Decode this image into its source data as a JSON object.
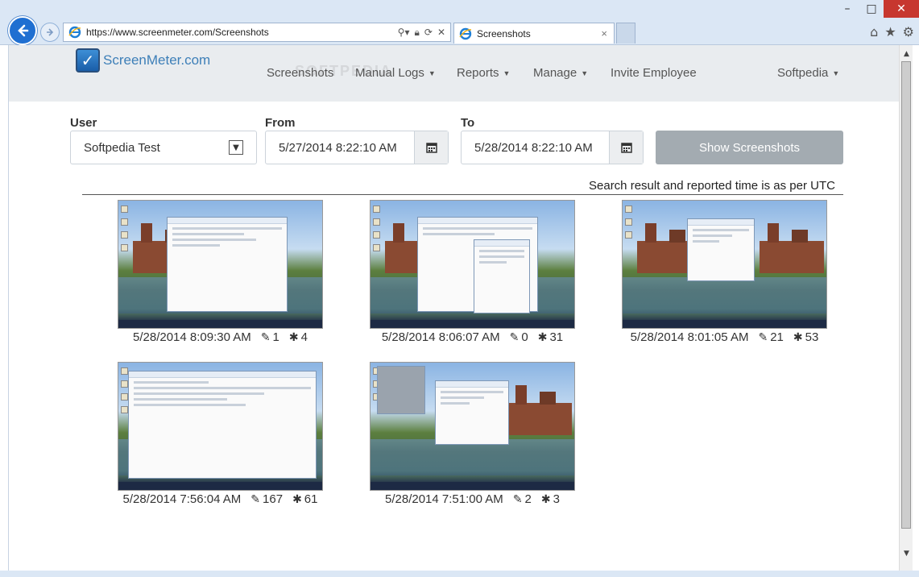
{
  "browser": {
    "url": "https://www.screenmeter.com/Screenshots",
    "tab_title": "Screenshots",
    "tab_close": "×"
  },
  "site": {
    "brand": "ScreenMeter.com",
    "watermark": "SOFTPEDIA",
    "nav": {
      "screenshots": "Screenshots",
      "manual_logs": "Manual Logs",
      "reports": "Reports",
      "manage": "Manage",
      "invite": "Invite Employee",
      "account": "Softpedia"
    }
  },
  "filters": {
    "user_label": "User",
    "user_value": "Softpedia Test",
    "from_label": "From",
    "from_value": "5/27/2014 8:22:10 AM",
    "to_label": "To",
    "to_value": "5/28/2014 8:22:10 AM",
    "show_button": "Show Screenshots"
  },
  "note": "Search result and reported time is as per UTC",
  "screenshots": [
    {
      "time": "5/28/2014 8:09:30 AM",
      "edits": "1",
      "clicks": "4"
    },
    {
      "time": "5/28/2014 8:06:07 AM",
      "edits": "0",
      "clicks": "31"
    },
    {
      "time": "5/28/2014 8:01:05 AM",
      "edits": "21",
      "clicks": "53"
    },
    {
      "time": "5/28/2014 7:56:04 AM",
      "edits": "167",
      "clicks": "61"
    },
    {
      "time": "5/28/2014 7:51:00 AM",
      "edits": "2",
      "clicks": "3"
    }
  ],
  "icons": {
    "edit": "edit-icon",
    "clicks": "asterisk-icon",
    "calendar": "calendar-icon"
  },
  "colors": {
    "brand": "#3d7fb8",
    "button": "#a3abb1",
    "header_bg": "#e9ecef"
  }
}
